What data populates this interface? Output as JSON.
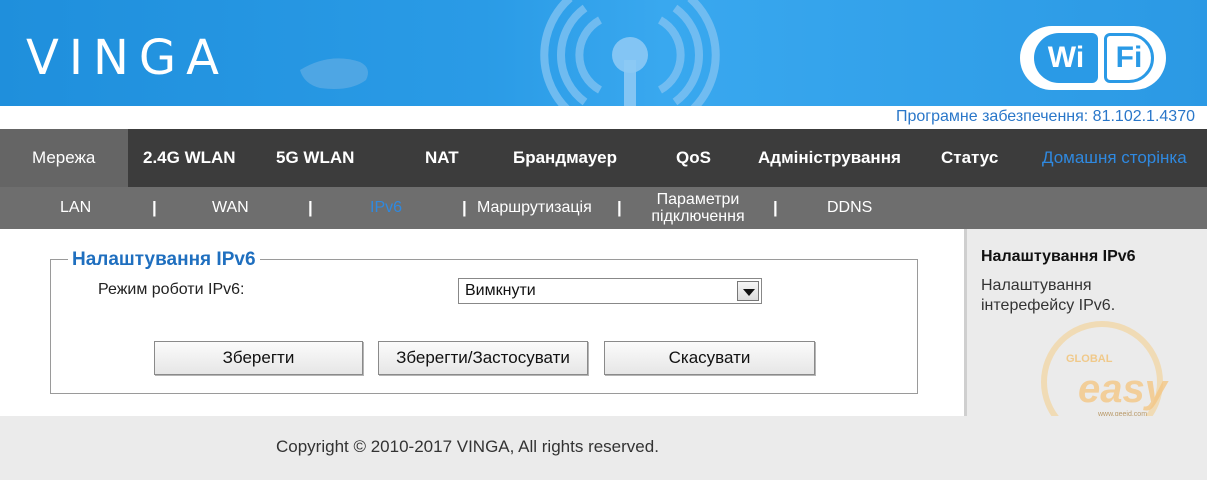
{
  "brand": {
    "logo": "VINGA",
    "badge_left": "Wi",
    "badge_right": "Fi"
  },
  "firmware": "Програмне забезпечення: 81.102.1.4370",
  "main_nav": [
    {
      "label": "Мережа"
    },
    {
      "label": "2.4G WLAN"
    },
    {
      "label": "5G WLAN"
    },
    {
      "label": "NAT"
    },
    {
      "label": "Брандмауер"
    },
    {
      "label": "QoS"
    },
    {
      "label": "Адміністрування"
    },
    {
      "label": "Статус"
    },
    {
      "label": "Домашня сторінка"
    }
  ],
  "sub_nav": [
    {
      "label": "LAN"
    },
    {
      "label": "WAN"
    },
    {
      "label": "IPv6"
    },
    {
      "label": "Маршрутизація"
    },
    {
      "label_line1": "Параметри",
      "label_line2": "підключення"
    },
    {
      "label": "DDNS"
    }
  ],
  "separator": "|",
  "form": {
    "legend": "Налаштування IPv6",
    "mode_label": "Режим роботи IPv6:",
    "mode_value": "Вимкнути",
    "buttons": {
      "save": "Зберегти",
      "save_apply": "Зберегти/Застосувати",
      "cancel": "Скасувати"
    }
  },
  "help": {
    "title": "Налаштування IPv6",
    "description": "Налаштування інтерефейсу IPv6."
  },
  "watermark": {
    "top_text": "GLOBAL",
    "brand": "easy",
    "url": "www.geeid.com"
  },
  "footer": {
    "copyright": "Copyright © 2010-2017 VINGA, All rights reserved."
  },
  "colors": {
    "header_blue": "#2a9ae6",
    "nav_dark": "#3c3c3c",
    "nav_active": "#656565",
    "subnav": "#6e6e6e",
    "link_blue": "#2f89e0",
    "legend_blue": "#1f6fbf"
  }
}
